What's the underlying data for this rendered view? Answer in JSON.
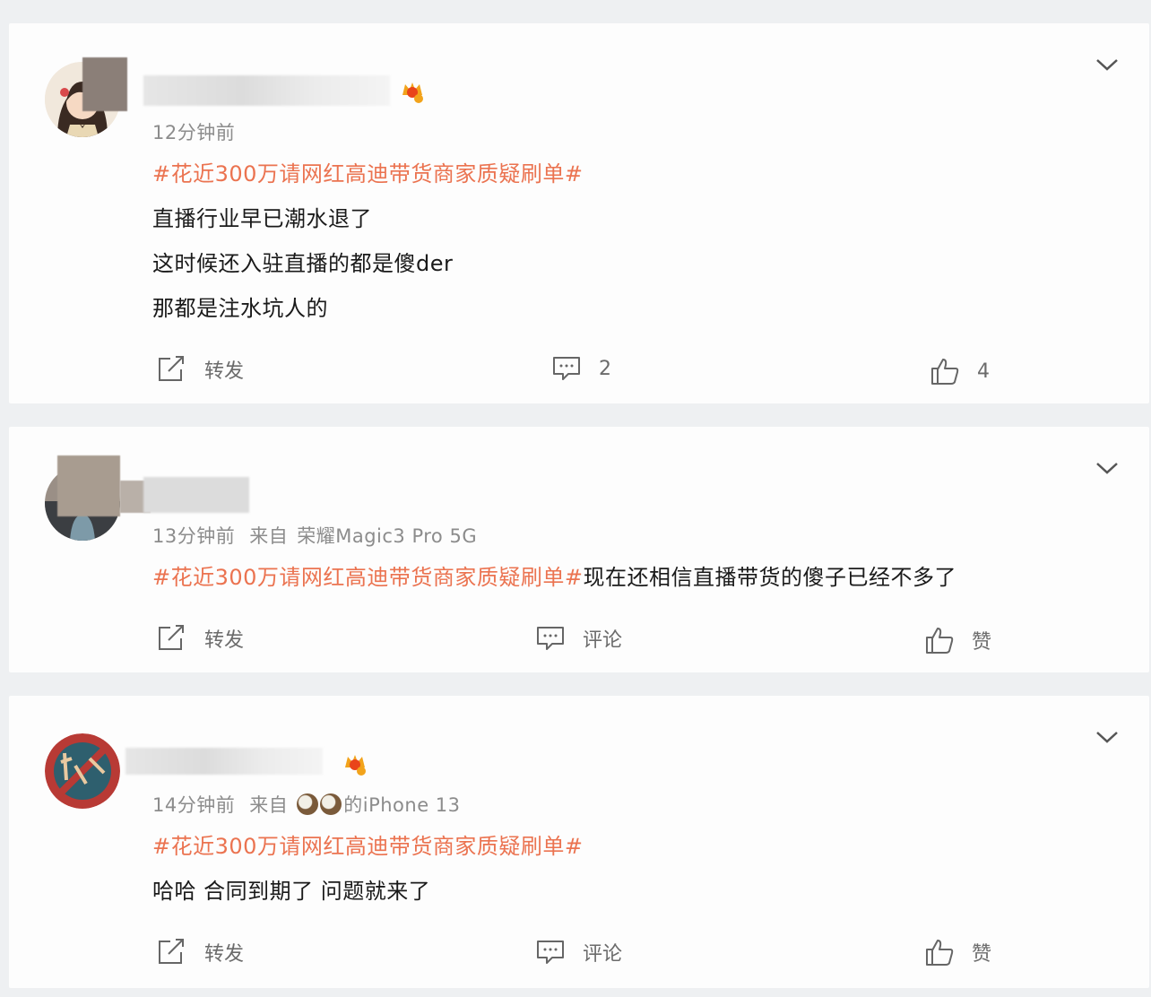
{
  "posts": [
    {
      "time": "12分钟前",
      "source_label": "",
      "device": "",
      "topic": "#花近300万请网红高迪带货商家质疑刷单#",
      "lines": [
        "直播行业早已潮水退了",
        "这时候还入驻直播的都是傻der",
        "那都是注水坑人的"
      ],
      "repost_label": "转发",
      "comment_label": "2",
      "like_label": "4"
    },
    {
      "time": "13分钟前",
      "source_label": "来自",
      "device": "荣耀Magic3 Pro 5G",
      "topic": "#花近300万请网红高迪带货商家质疑刷单#",
      "inline_text": "现在还相信直播带货的傻子已经不多了",
      "repost_label": "转发",
      "comment_label": "评论",
      "like_label": "赞"
    },
    {
      "time": "14分钟前",
      "source_label": "来自",
      "device": "的iPhone 13",
      "topic": "#花近300万请网红高迪带货商家质疑刷单#",
      "lines": [
        "哈哈 合同到期了 问题就来了"
      ],
      "repost_label": "转发",
      "comment_label": "评论",
      "like_label": "赞"
    }
  ],
  "colors": {
    "topic": "#eb7350",
    "page_bg": "#eef0f2",
    "card_bg": "#fdfdfd"
  },
  "icons": [
    "chevron-down-icon",
    "repost-icon",
    "comment-icon",
    "like-icon",
    "vip-crown-icon",
    "coin-emoji-icon"
  ]
}
